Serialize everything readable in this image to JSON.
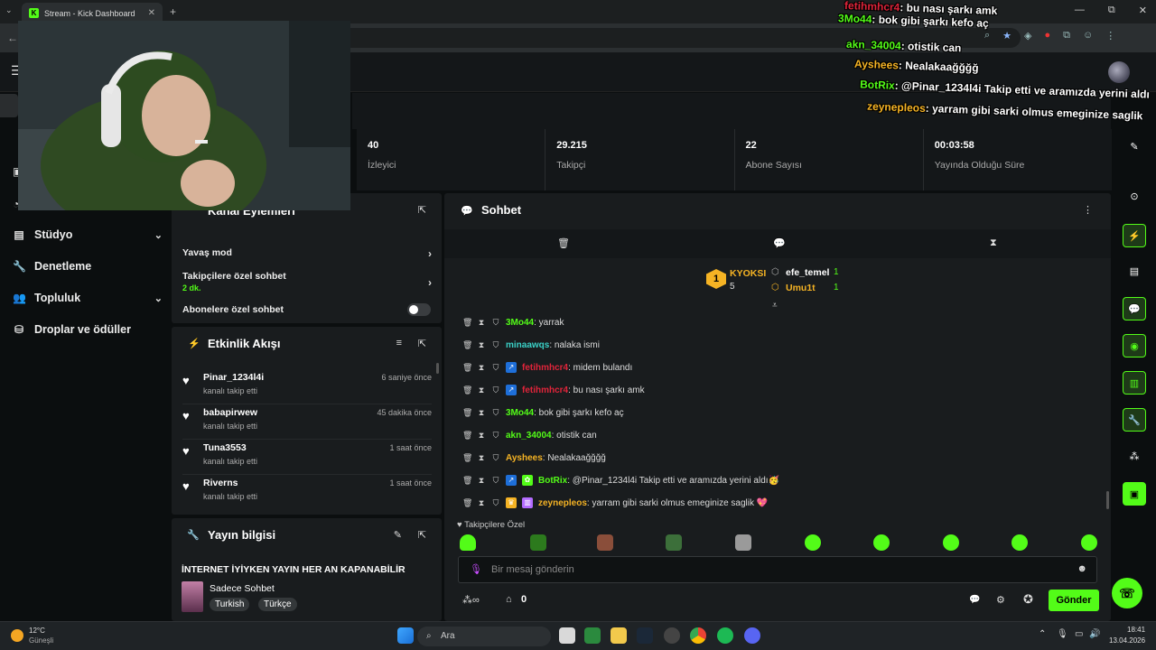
{
  "browser": {
    "tab_title": "Stream - Kick Dashboard",
    "tab_close": "✕",
    "new_tab": "+",
    "tab_menu": "⌄",
    "window_controls": [
      "—",
      "⧉",
      "✕"
    ],
    "back": "←"
  },
  "sidebar": {
    "items": [
      {
        "label": "Stüdyo",
        "icon": "studio-icon",
        "has_chevron": true
      },
      {
        "label": "Denetleme",
        "icon": "wrench-icon",
        "has_chevron": false
      },
      {
        "label": "Topluluk",
        "icon": "community-icon",
        "has_chevron": true
      },
      {
        "label": "Droplar ve ödüller",
        "icon": "gift-icon",
        "has_chevron": false
      }
    ],
    "chevron": "⌄"
  },
  "stats": [
    {
      "value": "40",
      "label": "İzleyici"
    },
    {
      "value": "29.215",
      "label": "Takipçi"
    },
    {
      "value": "22",
      "label": "Abone Sayısı"
    },
    {
      "value": "00:03:58",
      "label": "Yayında Olduğu Süre"
    }
  ],
  "channel_actions": {
    "title": "Kanal Eylemleri",
    "slow_mode": "Yavaş mod",
    "followers_only": "Takipçilere özel sohbet",
    "followers_only_sub": "2 dk.",
    "subscribers_only": "Abonelere özel sohbet",
    "arrow": "›"
  },
  "activity_feed": {
    "title": "Etkinlik Akışı",
    "items": [
      {
        "name": "Pinar_1234l4i",
        "desc": "kanalı takip etti",
        "time": "6 saniye önce"
      },
      {
        "name": "babapirwew",
        "desc": "kanalı takip etti",
        "time": "45 dakika önce"
      },
      {
        "name": "Tuna3553",
        "desc": "kanalı takip etti",
        "time": "1 saat önce"
      },
      {
        "name": "Riverns",
        "desc": "kanalı takip etti",
        "time": "1 saat önce"
      }
    ]
  },
  "stream_info": {
    "title": "Yayın bilgisi",
    "stream_title": "İNTERNET İYİYKEN YAYIN HER AN KAPANABİLİR",
    "category": "Sadece Sohbet",
    "tags": [
      "Turkish",
      "Türkçe"
    ]
  },
  "chat": {
    "title": "Sohbet",
    "top_gifters": [
      {
        "rank": "1",
        "name": "KYOKSI",
        "count": "5"
      },
      {
        "name": "efe_temel",
        "count": "1"
      },
      {
        "name": "Umu1t",
        "count": "1"
      }
    ],
    "messages": [
      {
        "user": "3Mo44",
        "color": "#53fc18",
        "text": ": yarrak",
        "badges": []
      },
      {
        "user": "minaawqs",
        "color": "#3ad1c7",
        "text": ": nalaka ismi",
        "badges": []
      },
      {
        "user": "fetihmhcr4",
        "color": "#e0243a",
        "text": ": midem bulandı",
        "badges": [
          "vip"
        ]
      },
      {
        "user": "fetihmhcr4",
        "color": "#e0243a",
        "text": ": bu nası şarkı amk",
        "badges": [
          "vip"
        ]
      },
      {
        "user": "3Mo44",
        "color": "#53fc18",
        "text": ": bok gibi şarkı kefo aç",
        "badges": []
      },
      {
        "user": "akn_34004",
        "color": "#53fc18",
        "text": ": otistik can",
        "badges": []
      },
      {
        "user": "Ayshees",
        "color": "#f5b324",
        "text": ": Nealakaağğğğ",
        "badges": []
      },
      {
        "user": "BotRix",
        "color": "#53fc18",
        "text": ": @Pinar_1234l4i Takip etti ve aramızda yerini aldı🥳",
        "badges": [
          "vip",
          "bot"
        ]
      },
      {
        "user": "zeynepleos",
        "color": "#f5b324",
        "text": ": yarram gibi sarki olmus emeginize saglik 💖",
        "badges": [
          "crown",
          "sub"
        ]
      }
    ],
    "followers_only_label": "♥ Takipçilere Özel",
    "input_placeholder": "Bir mesaj gönderin",
    "points": "0",
    "send_label": "Gönder"
  },
  "overlay_chat": [
    {
      "user": "fetihmhcr4",
      "text": ": bu nası şarkı amk"
    },
    {
      "user": "3Mo44",
      "text": ": bok gibi şarkı kefo aç"
    },
    {
      "user": "akn_34004",
      "text": ": otistik can"
    },
    {
      "user": "Ayshees",
      "text": ": Nealakaağğğğ"
    },
    {
      "user": "BotRix",
      "text": ": @Pinar_1234l4i Takip etti ve aramızda yerini aldı"
    },
    {
      "user": "zeynepleos",
      "text": ": yarram gibi sarki olmus emeginize saglik"
    }
  ],
  "taskbar": {
    "weather_temp": "12°C",
    "weather_desc": "Güneşli",
    "search": "Ara",
    "time": "18:41",
    "date": "13.04.2026"
  },
  "colors": {
    "accent": "#53fc18",
    "bg": "#0b0e0f",
    "panel": "#191c1e"
  }
}
